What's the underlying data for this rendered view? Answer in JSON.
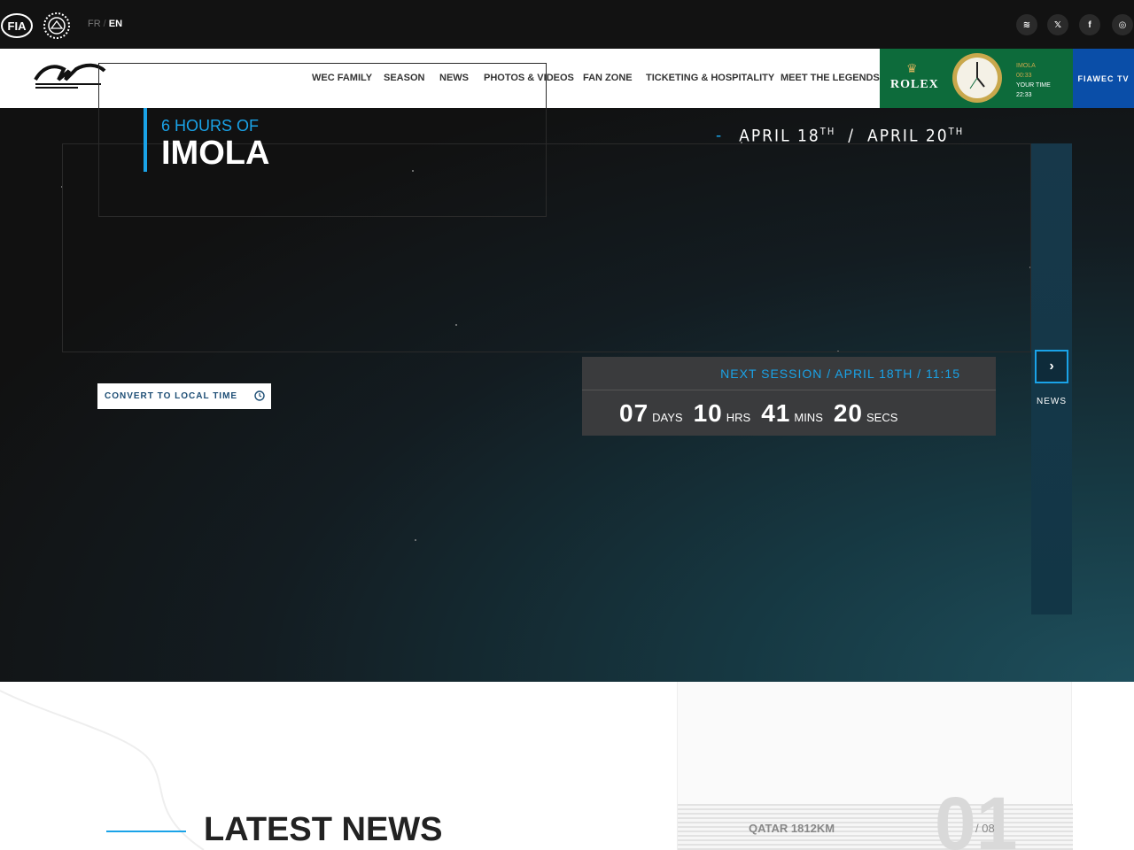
{
  "topbar": {
    "lang": {
      "fr": "FR",
      "separator": "/",
      "en": "EN"
    },
    "social": [
      {
        "icon": "spotify-icon",
        "glyph": "≋"
      },
      {
        "icon": "x-icon",
        "glyph": "𝕏"
      },
      {
        "icon": "facebook-icon",
        "glyph": "f"
      },
      {
        "icon": "instagram-icon",
        "glyph": "◎"
      }
    ]
  },
  "nav": {
    "items": [
      "WEC FAMILY",
      "SEASON",
      "NEWS",
      "PHOTOS & VIDEOS",
      "FAN ZONE",
      "TICKETING & HOSPITALITY",
      "MEET THE LEGENDS"
    ],
    "rolex": {
      "brand": "ROLEX",
      "location": "IMOLA",
      "location_time": "00:33",
      "your_time_label": "YOUR TIME",
      "your_time": "22:33"
    },
    "tv_label": "FIAWEC TV"
  },
  "hero": {
    "event_subtitle": "6 HOURS OF",
    "event_title": "IMOLA",
    "date_dash": "-",
    "date_start": "APRIL 18",
    "date_start_suffix": "TH",
    "date_sep": "/",
    "date_end": "APRIL 20",
    "date_end_suffix": "TH",
    "side_label": "NEWS",
    "convert_label": "CONVERT TO LOCAL TIME",
    "session_title": "NEXT SESSION / APRIL 18TH / 11:15",
    "countdown": {
      "days": "07",
      "days_label": "DAYS",
      "hrs": "10",
      "hrs_label": "HRS",
      "mins": "41",
      "mins_label": "MINS",
      "secs": "20",
      "secs_label": "SECS"
    },
    "accent_color": "#1aa3e8"
  },
  "lower": {
    "news_heading": "LATEST NEWS",
    "race_name": "QATAR 1812KM",
    "race_number": "01",
    "race_total": "/ 08"
  }
}
